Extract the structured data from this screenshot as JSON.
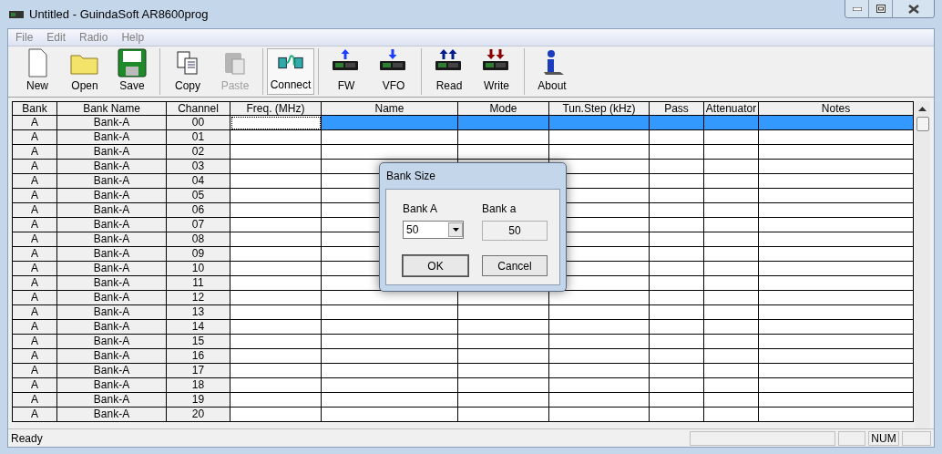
{
  "window": {
    "title": "Untitled - GuindaSoft AR8600prog"
  },
  "menu": [
    "File",
    "Edit",
    "Radio",
    "Help"
  ],
  "toolbar": [
    [
      {
        "label": "New",
        "kind": "new",
        "disabled": false,
        "pressed": false
      },
      {
        "label": "Open",
        "kind": "open",
        "disabled": false,
        "pressed": false
      },
      {
        "label": "Save",
        "kind": "save",
        "disabled": false,
        "pressed": false
      }
    ],
    [
      {
        "label": "Copy",
        "kind": "copy",
        "disabled": false,
        "pressed": false
      },
      {
        "label": "Paste",
        "kind": "paste",
        "disabled": true,
        "pressed": false
      }
    ],
    [
      {
        "label": "Connect",
        "kind": "connect",
        "disabled": false,
        "pressed": true
      }
    ],
    [
      {
        "label": "FW",
        "kind": "up",
        "disabled": false,
        "pressed": false
      },
      {
        "label": "VFO",
        "kind": "down",
        "disabled": false,
        "pressed": false
      }
    ],
    [
      {
        "label": "Read",
        "kind": "read",
        "disabled": false,
        "pressed": false
      },
      {
        "label": "Write",
        "kind": "write",
        "disabled": false,
        "pressed": false
      }
    ],
    [
      {
        "label": "About",
        "kind": "about",
        "disabled": false,
        "pressed": false
      }
    ]
  ],
  "table": {
    "columns": [
      "Bank",
      "Bank Name",
      "Channel",
      "Freq. (MHz)",
      "Name",
      "Mode",
      "Tun.Step (kHz)",
      "Pass",
      "Attenuator",
      "Notes"
    ],
    "rows": [
      {
        "bank": "A",
        "bank_name": "Bank-A",
        "channel": "00",
        "selected": true
      },
      {
        "bank": "A",
        "bank_name": "Bank-A",
        "channel": "01",
        "selected": false
      },
      {
        "bank": "A",
        "bank_name": "Bank-A",
        "channel": "02",
        "selected": false
      },
      {
        "bank": "A",
        "bank_name": "Bank-A",
        "channel": "03",
        "selected": false
      },
      {
        "bank": "A",
        "bank_name": "Bank-A",
        "channel": "04",
        "selected": false
      },
      {
        "bank": "A",
        "bank_name": "Bank-A",
        "channel": "05",
        "selected": false
      },
      {
        "bank": "A",
        "bank_name": "Bank-A",
        "channel": "06",
        "selected": false
      },
      {
        "bank": "A",
        "bank_name": "Bank-A",
        "channel": "07",
        "selected": false
      },
      {
        "bank": "A",
        "bank_name": "Bank-A",
        "channel": "08",
        "selected": false
      },
      {
        "bank": "A",
        "bank_name": "Bank-A",
        "channel": "09",
        "selected": false
      },
      {
        "bank": "A",
        "bank_name": "Bank-A",
        "channel": "10",
        "selected": false
      },
      {
        "bank": "A",
        "bank_name": "Bank-A",
        "channel": "11",
        "selected": false
      },
      {
        "bank": "A",
        "bank_name": "Bank-A",
        "channel": "12",
        "selected": false
      },
      {
        "bank": "A",
        "bank_name": "Bank-A",
        "channel": "13",
        "selected": false
      },
      {
        "bank": "A",
        "bank_name": "Bank-A",
        "channel": "14",
        "selected": false
      },
      {
        "bank": "A",
        "bank_name": "Bank-A",
        "channel": "15",
        "selected": false
      },
      {
        "bank": "A",
        "bank_name": "Bank-A",
        "channel": "16",
        "selected": false
      },
      {
        "bank": "A",
        "bank_name": "Bank-A",
        "channel": "17",
        "selected": false
      },
      {
        "bank": "A",
        "bank_name": "Bank-A",
        "channel": "18",
        "selected": false
      },
      {
        "bank": "A",
        "bank_name": "Bank-A",
        "channel": "19",
        "selected": false
      },
      {
        "bank": "A",
        "bank_name": "Bank-A",
        "channel": "20",
        "selected": false
      }
    ]
  },
  "dialog": {
    "title": "Bank Size",
    "bank_a_label": "Bank A",
    "bank_a_value": "50",
    "bank_b_label": "Bank a",
    "bank_b_value": "50",
    "buttons": [
      "OK",
      "Cancel"
    ]
  },
  "status_bar": {
    "text": "Ready",
    "indicator": "NUM"
  }
}
